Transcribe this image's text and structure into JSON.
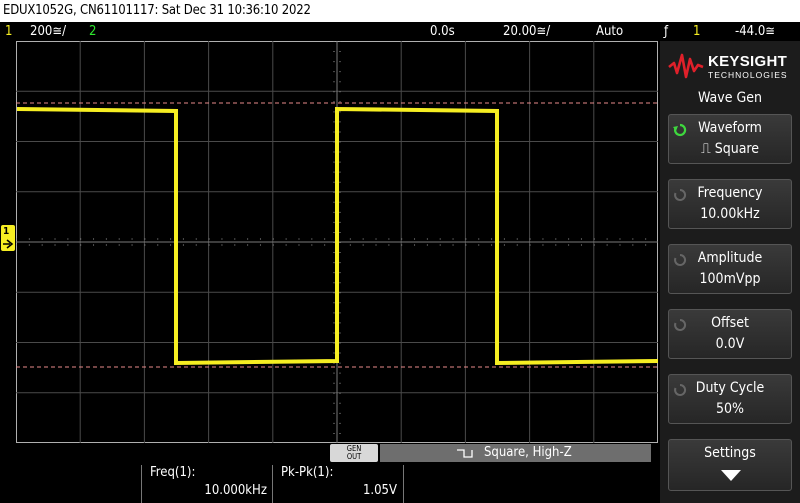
{
  "titlebar": {
    "text": "EDUX1052G, CN61101117: Sat Dec 31 10:36:10 2022"
  },
  "status": {
    "ch1_num": "1",
    "ch1_scale": "200≅/",
    "ch2_num": "2",
    "time_offset": "0.0s",
    "time_scale": "20.00≅/",
    "trigger_mode": "Auto",
    "trigger_symbol": "ƒ",
    "trigger_source": "1",
    "trigger_level": "-44.0≅"
  },
  "channel_marker": "1",
  "trace_color": "#f6ee22",
  "panel": {
    "brand_line1": "KEYSIGHT",
    "brand_line2": "TECHNOLOGIES",
    "menu_title": "Wave Gen",
    "softkeys": [
      {
        "label": "Waveform",
        "value": "⎍ Square"
      },
      {
        "label": "Frequency",
        "value": "10.00kHz"
      },
      {
        "label": "Amplitude",
        "value": "100mVpp"
      },
      {
        "label": "Offset",
        "value": "0.0V"
      },
      {
        "label": "Duty Cycle",
        "value": "50%"
      },
      {
        "label": "Settings",
        "value": ""
      }
    ]
  },
  "bottom": {
    "gen_out_1": "GEN",
    "gen_out_2": "OUT",
    "wave_status": "Square, High-Z",
    "measurements": [
      {
        "label": "Freq(1):",
        "value": "10.000kHz"
      },
      {
        "label": "Pk-Pk(1):",
        "value": "1.05V"
      }
    ]
  }
}
